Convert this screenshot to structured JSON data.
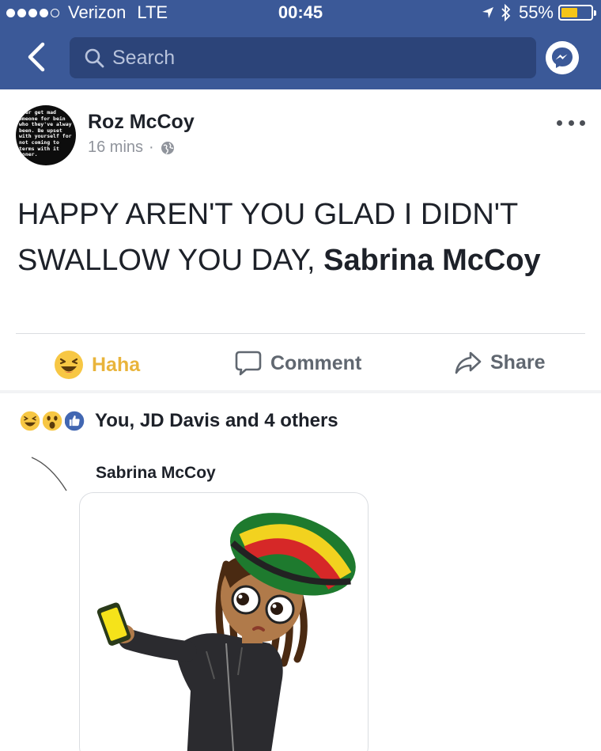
{
  "status_bar": {
    "carrier": "Verizon",
    "network": "LTE",
    "time": "00:45",
    "battery": "55%",
    "battery_level": 0.55,
    "signal_bars": 4,
    "icons": [
      "location-arrow-icon",
      "bluetooth-icon",
      "battery-icon"
    ]
  },
  "nav": {
    "search_placeholder": "Search",
    "back_icon": "chevron-left-icon",
    "messenger_icon": "messenger-icon"
  },
  "post": {
    "author": "Roz McCoy",
    "time": "16 mins",
    "separator": "·",
    "privacy_icon": "globe-icon",
    "text": "HAPPY AREN'T YOU GLAD I DIDN'T SWALLOW YOU DAY, ",
    "tagged": "Sabrina McCoy",
    "avatar_quote": "ever get mad\nomeone for bein\nwho they've alway\nbeen. Be upset\nwith yourself for\nnot coming to\nterms with it\nooner."
  },
  "actions": {
    "haha": "Haha",
    "comment": "Comment",
    "share": "Share"
  },
  "reactions": {
    "summary": "You, JD Davis and 4 others",
    "icons": [
      "haha-icon",
      "wow-icon",
      "like-icon"
    ]
  },
  "comment": {
    "author": "Sabrina McCoy"
  },
  "colors": {
    "header": "#3b5998",
    "search": "#2c4479",
    "haha": "#e9b43b",
    "like": "#4267b2"
  }
}
